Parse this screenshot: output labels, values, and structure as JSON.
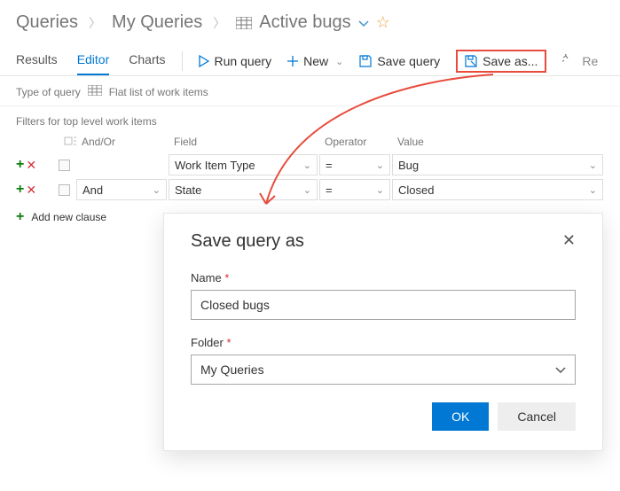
{
  "breadcrumb": {
    "root": "Queries",
    "mid": "My Queries",
    "leaf": "Active bugs"
  },
  "tabs": {
    "results": "Results",
    "editor": "Editor",
    "charts": "Charts"
  },
  "toolbar": {
    "run": "Run query",
    "new": "New",
    "save": "Save query",
    "saveas": "Save as...",
    "re": "Re"
  },
  "typeRow": {
    "label": "Type of query",
    "value": "Flat list of work items"
  },
  "filters": {
    "title": "Filters for top level work items",
    "headers": {
      "andor": "And/Or",
      "field": "Field",
      "operator": "Operator",
      "value": "Value"
    },
    "rows": [
      {
        "andor": "",
        "field": "Work Item Type",
        "operator": "=",
        "value": "Bug"
      },
      {
        "andor": "And",
        "field": "State",
        "operator": "=",
        "value": "Closed"
      }
    ],
    "addClause": "Add new clause"
  },
  "dialog": {
    "title": "Save query as",
    "nameLabel": "Name",
    "nameValue": "Closed bugs",
    "folderLabel": "Folder",
    "folderValue": "My Queries",
    "ok": "OK",
    "cancel": "Cancel"
  }
}
